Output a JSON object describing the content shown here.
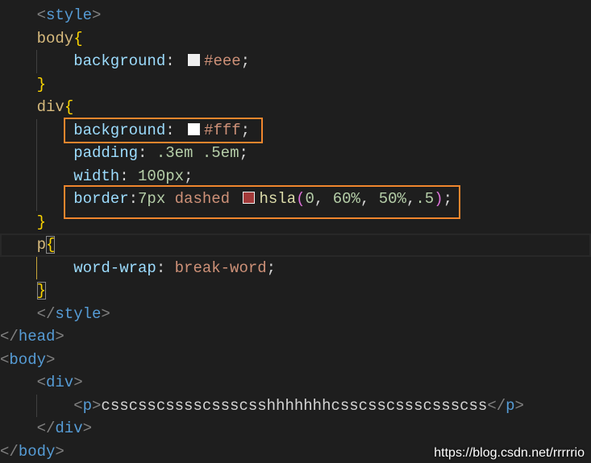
{
  "editor": {
    "background": "#1e1e1e",
    "cursor_line": 11,
    "lines": [
      {
        "indent": 1,
        "tokens": [
          {
            "text": "<",
            "color": "#808080"
          },
          {
            "text": "style",
            "color": "#569cd6"
          },
          {
            "text": ">",
            "color": "#808080"
          }
        ]
      },
      {
        "indent": 1,
        "tokens": [
          {
            "text": "body",
            "color": "#d7ba7d"
          },
          {
            "text": "{",
            "color": "#ffd700"
          }
        ]
      },
      {
        "indent": 2,
        "tokens": [
          {
            "text": "background",
            "color": "#9cdcfe"
          },
          {
            "text": ": ",
            "color": "#d4d4d4"
          },
          {
            "swatch": "#eeeeee"
          },
          {
            "text": "#eee",
            "color": "#ce9178"
          },
          {
            "text": ";",
            "color": "#d4d4d4"
          }
        ]
      },
      {
        "indent": 1,
        "tokens": [
          {
            "text": "}",
            "color": "#ffd700"
          }
        ]
      },
      {
        "indent": 1,
        "tokens": [
          {
            "text": "div",
            "color": "#d7ba7d"
          },
          {
            "text": "{",
            "color": "#ffd700"
          }
        ]
      },
      {
        "indent": 2,
        "tokens": [
          {
            "text": "background",
            "color": "#9cdcfe"
          },
          {
            "text": ": ",
            "color": "#d4d4d4"
          },
          {
            "swatch": "#ffffff"
          },
          {
            "text": "#fff",
            "color": "#ce9178"
          },
          {
            "text": ";",
            "color": "#d4d4d4"
          }
        ]
      },
      {
        "indent": 2,
        "tokens": [
          {
            "text": "padding",
            "color": "#9cdcfe"
          },
          {
            "text": ": ",
            "color": "#d4d4d4"
          },
          {
            "text": ".3em",
            "color": "#b5cea8"
          },
          {
            "text": " ",
            "color": "#d4d4d4"
          },
          {
            "text": ".5em",
            "color": "#b5cea8"
          },
          {
            "text": ";",
            "color": "#d4d4d4"
          }
        ]
      },
      {
        "indent": 2,
        "tokens": [
          {
            "text": "width",
            "color": "#9cdcfe"
          },
          {
            "text": ": ",
            "color": "#d4d4d4"
          },
          {
            "text": "100px",
            "color": "#b5cea8"
          },
          {
            "text": ";",
            "color": "#d4d4d4"
          }
        ]
      },
      {
        "indent": 2,
        "tokens": [
          {
            "text": "border",
            "color": "#9cdcfe"
          },
          {
            "text": ":",
            "color": "#d4d4d4"
          },
          {
            "text": "7px",
            "color": "#b5cea8"
          },
          {
            "text": " ",
            "color": "#d4d4d4"
          },
          {
            "text": "dashed",
            "color": "#ce9178"
          },
          {
            "text": " ",
            "color": "#d4d4d4"
          },
          {
            "swatch": "#a33a3a"
          },
          {
            "text": "hsla",
            "color": "#dcdcaa"
          },
          {
            "text": "(",
            "color": "#da70d6"
          },
          {
            "text": "0",
            "color": "#b5cea8"
          },
          {
            "text": ", ",
            "color": "#d4d4d4"
          },
          {
            "text": "60%",
            "color": "#b5cea8"
          },
          {
            "text": ", ",
            "color": "#d4d4d4"
          },
          {
            "text": "50%",
            "color": "#b5cea8"
          },
          {
            "text": ",",
            "color": "#d4d4d4"
          },
          {
            "text": ".5",
            "color": "#b5cea8"
          },
          {
            "text": ")",
            "color": "#da70d6"
          },
          {
            "text": ";",
            "color": "#d4d4d4"
          }
        ]
      },
      {
        "indent": 1,
        "tokens": [
          {
            "text": "}",
            "color": "#ffd700"
          }
        ]
      },
      {
        "indent": 1,
        "tokens": [
          {
            "text": "p",
            "color": "#d7ba7d"
          },
          {
            "text": "{",
            "color": "#ffd700",
            "match": true
          }
        ]
      },
      {
        "indent": 2,
        "tokens": [
          {
            "text": "word-wrap",
            "color": "#9cdcfe"
          },
          {
            "text": ": ",
            "color": "#d4d4d4"
          },
          {
            "text": "break-word",
            "color": "#ce9178"
          },
          {
            "text": ";",
            "color": "#d4d4d4"
          }
        ]
      },
      {
        "indent": 1,
        "tokens": [
          {
            "text": "}",
            "color": "#ffd700",
            "match": true
          }
        ]
      },
      {
        "indent": 1,
        "tokens": [
          {
            "text": "</",
            "color": "#808080"
          },
          {
            "text": "style",
            "color": "#569cd6"
          },
          {
            "text": ">",
            "color": "#808080"
          }
        ]
      },
      {
        "indent": 0,
        "tokens": [
          {
            "text": "</",
            "color": "#808080"
          },
          {
            "text": "head",
            "color": "#569cd6"
          },
          {
            "text": ">",
            "color": "#808080"
          }
        ]
      },
      {
        "indent": 0,
        "tokens": [
          {
            "text": "<",
            "color": "#808080"
          },
          {
            "text": "body",
            "color": "#569cd6"
          },
          {
            "text": ">",
            "color": "#808080"
          }
        ]
      },
      {
        "indent": 1,
        "tokens": [
          {
            "text": "<",
            "color": "#808080"
          },
          {
            "text": "div",
            "color": "#569cd6"
          },
          {
            "text": ">",
            "color": "#808080"
          }
        ]
      },
      {
        "indent": 2,
        "tokens": [
          {
            "text": "<",
            "color": "#808080"
          },
          {
            "text": "p",
            "color": "#569cd6"
          },
          {
            "text": ">",
            "color": "#808080"
          },
          {
            "text": "csscsscsssscssscsshhhhhhhcsscsscssscssscss",
            "color": "#d4d4d4"
          },
          {
            "text": "</",
            "color": "#808080"
          },
          {
            "text": "p",
            "color": "#569cd6"
          },
          {
            "text": ">",
            "color": "#808080"
          }
        ]
      },
      {
        "indent": 1,
        "tokens": [
          {
            "text": "</",
            "color": "#808080"
          },
          {
            "text": "div",
            "color": "#569cd6"
          },
          {
            "text": ">",
            "color": "#808080"
          }
        ]
      },
      {
        "indent": 0,
        "tokens": [
          {
            "text": "</",
            "color": "#808080"
          },
          {
            "text": "body",
            "color": "#569cd6"
          },
          {
            "text": ">",
            "color": "#808080"
          }
        ]
      }
    ]
  },
  "annotations": {
    "color": "#f0862d"
  },
  "watermark": "https://blog.csdn.net/rrrrrio"
}
